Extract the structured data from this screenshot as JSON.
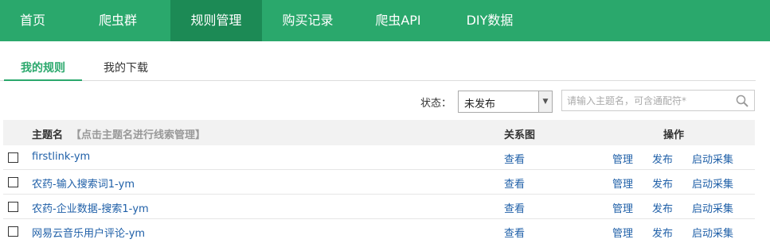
{
  "nav": {
    "items": [
      {
        "label": "首页"
      },
      {
        "label": "爬虫群"
      },
      {
        "label": "规则管理"
      },
      {
        "label": "购买记录"
      },
      {
        "label": "爬虫API"
      },
      {
        "label": "DIY数据"
      }
    ],
    "active_index": 2
  },
  "subtabs": {
    "items": [
      {
        "label": "我的规则"
      },
      {
        "label": "我的下载"
      }
    ],
    "active_index": 0
  },
  "filter": {
    "status_label": "状态：",
    "status_value": "未发布",
    "search_placeholder": "请输入主题名，可含通配符*"
  },
  "table": {
    "header": {
      "name": "主题名",
      "hint": "【点击主题名进行线索管理】",
      "relation": "关系图",
      "operations": "操作"
    },
    "rows": [
      {
        "name": "firstlink-ym",
        "view": "查看",
        "manage": "管理",
        "publish": "发布",
        "start": "启动采集"
      },
      {
        "name": "农药-输入搜索词1-ym",
        "view": "查看",
        "manage": "管理",
        "publish": "发布",
        "start": "启动采集"
      },
      {
        "name": "农药-企业数据-搜索1-ym",
        "view": "查看",
        "manage": "管理",
        "publish": "发布",
        "start": "启动采集"
      },
      {
        "name": "网易云音乐用户评论-ym",
        "view": "查看",
        "manage": "管理",
        "publish": "发布",
        "start": "启动采集"
      }
    ]
  },
  "colors": {
    "nav_bg": "#2aa86c",
    "nav_active_bg": "#1c8a55",
    "accent": "#2aa86c",
    "link": "#2060a8"
  }
}
